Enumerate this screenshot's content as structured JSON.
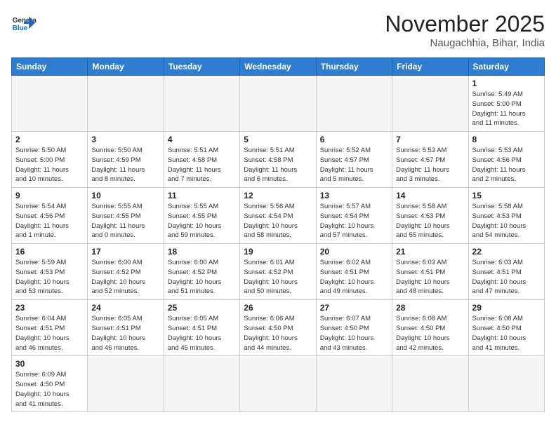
{
  "logo": {
    "line1": "General",
    "line2": "Blue"
  },
  "title": "November 2025",
  "location": "Naugachhia, Bihar, India",
  "weekdays": [
    "Sunday",
    "Monday",
    "Tuesday",
    "Wednesday",
    "Thursday",
    "Friday",
    "Saturday"
  ],
  "weeks": [
    [
      {
        "day": null,
        "info": null
      },
      {
        "day": null,
        "info": null
      },
      {
        "day": null,
        "info": null
      },
      {
        "day": null,
        "info": null
      },
      {
        "day": null,
        "info": null
      },
      {
        "day": null,
        "info": null
      },
      {
        "day": "1",
        "info": "Sunrise: 5:49 AM\nSunset: 5:00 PM\nDaylight: 11 hours\nand 11 minutes."
      }
    ],
    [
      {
        "day": "2",
        "info": "Sunrise: 5:50 AM\nSunset: 5:00 PM\nDaylight: 11 hours\nand 10 minutes."
      },
      {
        "day": "3",
        "info": "Sunrise: 5:50 AM\nSunset: 4:59 PM\nDaylight: 11 hours\nand 8 minutes."
      },
      {
        "day": "4",
        "info": "Sunrise: 5:51 AM\nSunset: 4:58 PM\nDaylight: 11 hours\nand 7 minutes."
      },
      {
        "day": "5",
        "info": "Sunrise: 5:51 AM\nSunset: 4:58 PM\nDaylight: 11 hours\nand 6 minutes."
      },
      {
        "day": "6",
        "info": "Sunrise: 5:52 AM\nSunset: 4:57 PM\nDaylight: 11 hours\nand 5 minutes."
      },
      {
        "day": "7",
        "info": "Sunrise: 5:53 AM\nSunset: 4:57 PM\nDaylight: 11 hours\nand 3 minutes."
      },
      {
        "day": "8",
        "info": "Sunrise: 5:53 AM\nSunset: 4:56 PM\nDaylight: 11 hours\nand 2 minutes."
      }
    ],
    [
      {
        "day": "9",
        "info": "Sunrise: 5:54 AM\nSunset: 4:56 PM\nDaylight: 11 hours\nand 1 minute."
      },
      {
        "day": "10",
        "info": "Sunrise: 5:55 AM\nSunset: 4:55 PM\nDaylight: 11 hours\nand 0 minutes."
      },
      {
        "day": "11",
        "info": "Sunrise: 5:55 AM\nSunset: 4:55 PM\nDaylight: 10 hours\nand 59 minutes."
      },
      {
        "day": "12",
        "info": "Sunrise: 5:56 AM\nSunset: 4:54 PM\nDaylight: 10 hours\nand 58 minutes."
      },
      {
        "day": "13",
        "info": "Sunrise: 5:57 AM\nSunset: 4:54 PM\nDaylight: 10 hours\nand 57 minutes."
      },
      {
        "day": "14",
        "info": "Sunrise: 5:58 AM\nSunset: 4:53 PM\nDaylight: 10 hours\nand 55 minutes."
      },
      {
        "day": "15",
        "info": "Sunrise: 5:58 AM\nSunset: 4:53 PM\nDaylight: 10 hours\nand 54 minutes."
      }
    ],
    [
      {
        "day": "16",
        "info": "Sunrise: 5:59 AM\nSunset: 4:53 PM\nDaylight: 10 hours\nand 53 minutes."
      },
      {
        "day": "17",
        "info": "Sunrise: 6:00 AM\nSunset: 4:52 PM\nDaylight: 10 hours\nand 52 minutes."
      },
      {
        "day": "18",
        "info": "Sunrise: 6:00 AM\nSunset: 4:52 PM\nDaylight: 10 hours\nand 51 minutes."
      },
      {
        "day": "19",
        "info": "Sunrise: 6:01 AM\nSunset: 4:52 PM\nDaylight: 10 hours\nand 50 minutes."
      },
      {
        "day": "20",
        "info": "Sunrise: 6:02 AM\nSunset: 4:51 PM\nDaylight: 10 hours\nand 49 minutes."
      },
      {
        "day": "21",
        "info": "Sunrise: 6:03 AM\nSunset: 4:51 PM\nDaylight: 10 hours\nand 48 minutes."
      },
      {
        "day": "22",
        "info": "Sunrise: 6:03 AM\nSunset: 4:51 PM\nDaylight: 10 hours\nand 47 minutes."
      }
    ],
    [
      {
        "day": "23",
        "info": "Sunrise: 6:04 AM\nSunset: 4:51 PM\nDaylight: 10 hours\nand 46 minutes."
      },
      {
        "day": "24",
        "info": "Sunrise: 6:05 AM\nSunset: 4:51 PM\nDaylight: 10 hours\nand 46 minutes."
      },
      {
        "day": "25",
        "info": "Sunrise: 6:05 AM\nSunset: 4:51 PM\nDaylight: 10 hours\nand 45 minutes."
      },
      {
        "day": "26",
        "info": "Sunrise: 6:06 AM\nSunset: 4:50 PM\nDaylight: 10 hours\nand 44 minutes."
      },
      {
        "day": "27",
        "info": "Sunrise: 6:07 AM\nSunset: 4:50 PM\nDaylight: 10 hours\nand 43 minutes."
      },
      {
        "day": "28",
        "info": "Sunrise: 6:08 AM\nSunset: 4:50 PM\nDaylight: 10 hours\nand 42 minutes."
      },
      {
        "day": "29",
        "info": "Sunrise: 6:08 AM\nSunset: 4:50 PM\nDaylight: 10 hours\nand 41 minutes."
      }
    ],
    [
      {
        "day": "30",
        "info": "Sunrise: 6:09 AM\nSunset: 4:50 PM\nDaylight: 10 hours\nand 41 minutes."
      },
      {
        "day": null,
        "info": null
      },
      {
        "day": null,
        "info": null
      },
      {
        "day": null,
        "info": null
      },
      {
        "day": null,
        "info": null
      },
      {
        "day": null,
        "info": null
      },
      {
        "day": null,
        "info": null
      }
    ]
  ]
}
